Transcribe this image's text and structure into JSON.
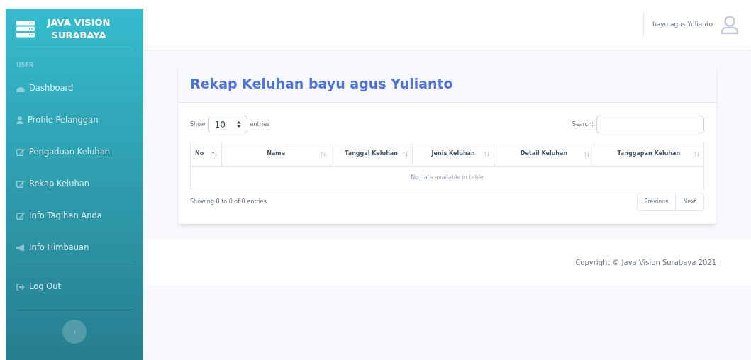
{
  "brand": {
    "title": "JAVA VISION SURABAYA"
  },
  "sidebar": {
    "heading": "USER",
    "items": [
      {
        "label": "Dashboard",
        "kind": "gauge",
        "selected": false
      },
      {
        "label": "Profile Pelanggan",
        "kind": "user",
        "selected": false
      },
      {
        "label": "Pengaduan Keluhan",
        "kind": "edit",
        "selected": false
      },
      {
        "label": "Rekap Keluhan",
        "kind": "edit",
        "selected": false
      },
      {
        "label": "Info Tagihan Anda",
        "kind": "edit",
        "selected": false
      },
      {
        "label": "Info Himbauan",
        "kind": "megaphone",
        "selected": false
      }
    ],
    "logout": {
      "label": "Log Out"
    },
    "toggle": {
      "label": "‹"
    }
  },
  "topbar": {
    "user": "bayu agus Yulianto"
  },
  "card": {
    "title": "Rekap Keluhan bayu agus Yulianto",
    "length": {
      "show": "Show",
      "value": "10",
      "entries": "entries"
    },
    "search": {
      "label": "Search:"
    },
    "table": {
      "columns": [
        {
          "label": "No",
          "sorted": true
        },
        {
          "label": "Nama",
          "sorted": false
        },
        {
          "label": "Tanggal Keluhan",
          "sorted": false
        },
        {
          "label": "Jenis Keluhan",
          "sorted": false
        },
        {
          "label": "Detail Keluhan",
          "sorted": false
        },
        {
          "label": "Tanggapan Keluhan",
          "sorted": false
        }
      ],
      "empty": "No data available in table"
    },
    "info": "Showing 0 to 0 of 0 entries",
    "pagination": [
      "Previous",
      "Next"
    ]
  },
  "footer": {
    "copyright": "Copyright © Java Vision Surabaya 2021"
  }
}
